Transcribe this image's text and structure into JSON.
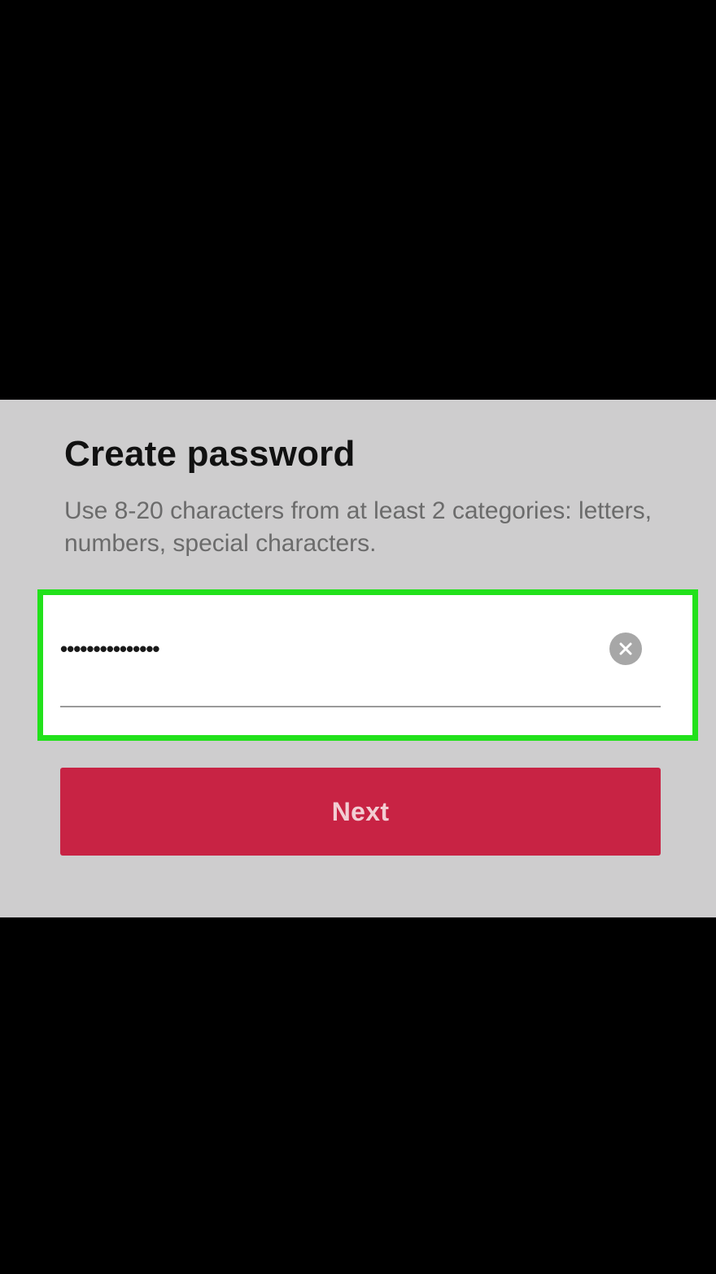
{
  "dialog": {
    "title": "Create password",
    "hint": "Use 8-20 characters from at least 2 categories: letters, numbers, special characters."
  },
  "password_field": {
    "value": "•••••••••••••••",
    "clear_icon": "close-circle-icon"
  },
  "buttons": {
    "next_label": "Next"
  },
  "colors": {
    "background": "#000000",
    "panel": "#cecdce",
    "highlight": "#22e11b",
    "primary_button": "#c82344"
  }
}
